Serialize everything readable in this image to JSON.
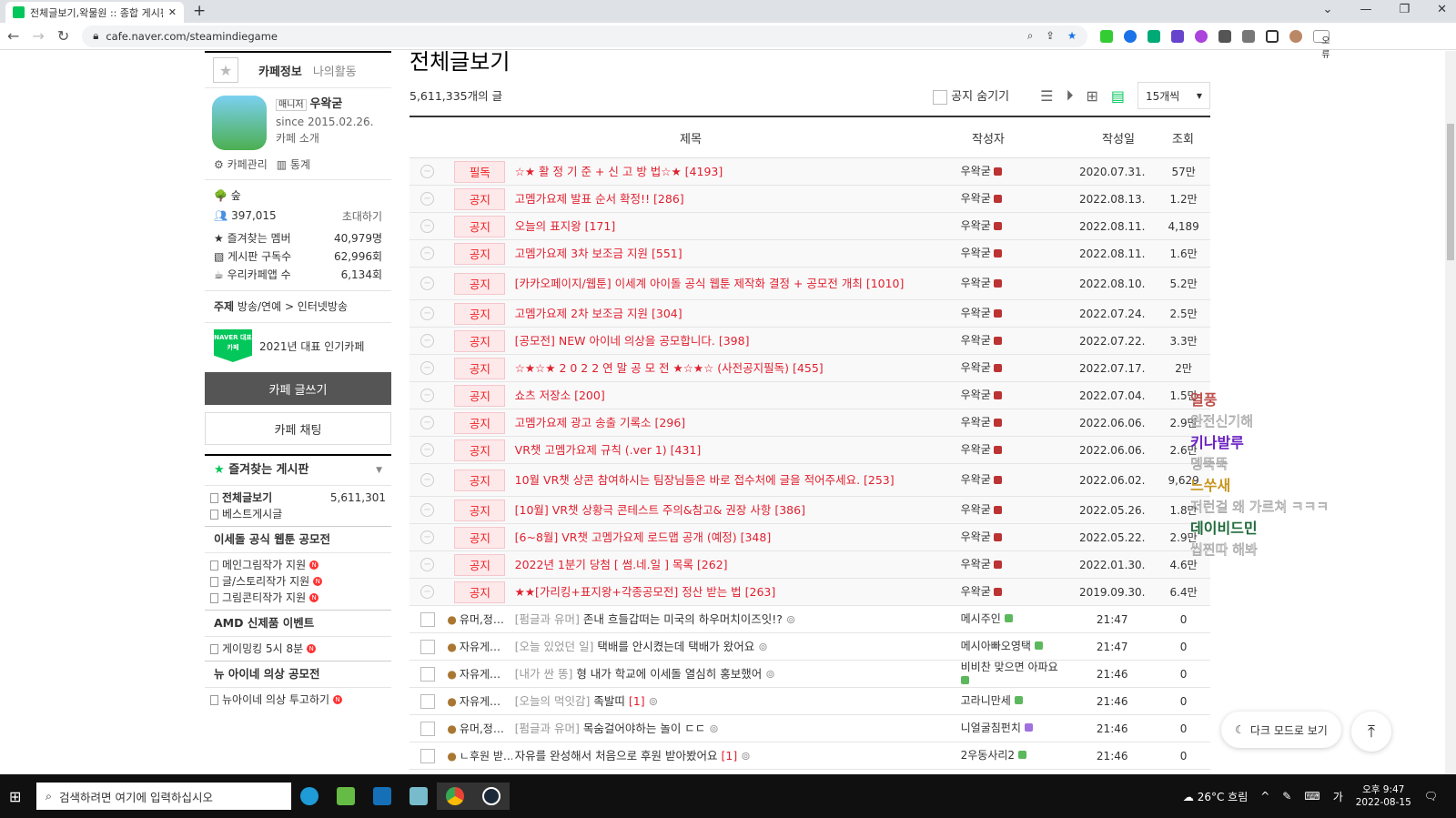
{
  "browser": {
    "tab_title": "전체글보기,왁물원 :: 종합 게시판",
    "url": "cafe.naver.com/steamindiegame",
    "profile": "오류"
  },
  "side": {
    "tabs": [
      "카페정보",
      "나의활동"
    ],
    "manager_label": "매니저",
    "manager": "우왁굳",
    "since": "since 2015.02.26.",
    "intro": "카페 소개",
    "admin": "카페관리",
    "stats": "통계",
    "level": "숲",
    "members": "397,015",
    "invite": "초대하기",
    "stats_rows": [
      {
        "label": "즐겨찾는 멤버",
        "value": "40,979명"
      },
      {
        "label": "게시판 구독수",
        "value": "62,996회"
      },
      {
        "label": "우리카페앱 수",
        "value": "6,134회"
      }
    ],
    "topic_label": "주제",
    "topic": "방송/연예 > 인터넷방송",
    "naver_badge": "NAVER 대표카페",
    "award": "2021년 대표 인기카페",
    "write": "카페 글쓰기",
    "chat": "카페 채팅",
    "fav_boards": "즐겨찾는 게시판",
    "all_posts": "전체글보기",
    "all_count": "5,611,301",
    "best": "베스트게시글",
    "sections": [
      {
        "title": "이세돌 공식 웹툰 공모전",
        "items": [
          "메인그림작가 지원",
          "글/스토리작가 지원",
          "그림콘티작가 지원"
        ]
      },
      {
        "title": "AMD 신제품 이벤트",
        "items": [
          "게이밍킹 5시 8분"
        ]
      },
      {
        "title": "뉴 아이네 의상 공모전",
        "items": [
          "뉴아이네 의상 투고하기"
        ]
      }
    ]
  },
  "main": {
    "title": "전체글보기",
    "count": "5,611,335개의 글",
    "hide_notice": "공지 숨기기",
    "per_page": "15개씩",
    "headers": [
      "제목",
      "작성자",
      "작성일",
      "조회"
    ],
    "notices": [
      {
        "badge": "필독",
        "title": "☆★ 활 정 기 준 + 신 고 방 법☆★ [4193]",
        "author": "우왁굳",
        "date": "2020.07.31.",
        "views": "57만"
      },
      {
        "badge": "공지",
        "title": "고멤가요제 발표 순서 확정!! [286]",
        "author": "우왁굳",
        "date": "2022.08.13.",
        "views": "1.2만"
      },
      {
        "badge": "공지",
        "title": "오늘의 표지왕 [171]",
        "author": "우왁굳",
        "date": "2022.08.11.",
        "views": "4,189"
      },
      {
        "badge": "공지",
        "title": "고멤가요제 3차 보조금 지원 [551]",
        "author": "우왁굳",
        "date": "2022.08.11.",
        "views": "1.6만"
      },
      {
        "badge": "공지",
        "title": "[카카오페이지/웹툰] 이세계 아이돌 공식 웹툰 제작화 결정 + 공모전 개최 [1010]",
        "author": "우왁굳",
        "date": "2022.08.10.",
        "views": "5.2만",
        "tall": true
      },
      {
        "badge": "공지",
        "title": "고멤가요제 2차 보조금 지원 [304]",
        "author": "우왁굳",
        "date": "2022.07.24.",
        "views": "2.5만"
      },
      {
        "badge": "공지",
        "title": "[공모전] NEW 아이네 의상을 공모합니다. [398]",
        "author": "우왁굳",
        "date": "2022.07.22.",
        "views": "3.3만"
      },
      {
        "badge": "공지",
        "title": "☆★☆★ 2 0 2 2 연 말 공 모 전 ★☆★☆ (사전공지필독) [455]",
        "author": "우왁굳",
        "date": "2022.07.17.",
        "views": "2만"
      },
      {
        "badge": "공지",
        "title": "쇼츠 저장소 [200]",
        "author": "우왁굳",
        "date": "2022.07.04.",
        "views": "1.5만"
      },
      {
        "badge": "공지",
        "title": "고멤가요제 광고 송출 기록소 [296]",
        "author": "우왁굳",
        "date": "2022.06.06.",
        "views": "2.9만"
      },
      {
        "badge": "공지",
        "title": "VR챗 고멤가요제 규칙 (.ver 1) [431]",
        "author": "우왁굳",
        "date": "2022.06.06.",
        "views": "2.6만"
      },
      {
        "badge": "공지",
        "title": "10월 VR챗 상콘 참여하시는 팀장님들은 바로 접수처에 글을 적어주세요. [253]",
        "author": "우왁굳",
        "date": "2022.06.02.",
        "views": "9,629",
        "tall": true
      },
      {
        "badge": "공지",
        "title": "[10월] VR챗 상황극 콘테스트 주의&참고& 권장 사항 [386]",
        "author": "우왁굳",
        "date": "2022.05.26.",
        "views": "1.8만"
      },
      {
        "badge": "공지",
        "title": "[6~8월] VR챗 고멤가요제 로드맵 공개 (예정) [348]",
        "author": "우왁굳",
        "date": "2022.05.22.",
        "views": "2.9만"
      },
      {
        "badge": "공지",
        "title": "2022년 1분기 당첨 [ 썸.네.일 ] 목록 [262]",
        "author": "우왁굳",
        "date": "2022.01.30.",
        "views": "4.6만"
      },
      {
        "badge": "공지",
        "title": "★★[가리킹+표지왕+각종공모전] 정산 받는 법 [263]",
        "author": "우왁굳",
        "date": "2019.09.30.",
        "views": "6.4만"
      }
    ],
    "posts": [
      {
        "board": "유머,정…",
        "prefix": "[펌글과 유머]",
        "title": "존내 흐들갑떠는 미국의 하우머치이즈잇!?",
        "cmt": "",
        "author": "메시주인",
        "date": "21:47",
        "views": "0",
        "lv": "#5cb85c"
      },
      {
        "board": "자유게…",
        "prefix": "[오늘 있었던 일]",
        "title": "택배를 안시켰는데 택배가 왔어요",
        "cmt": "",
        "author": "메시아빠오영택",
        "date": "21:47",
        "views": "0",
        "lv": "#5cb85c"
      },
      {
        "board": "자유게…",
        "prefix": "[내가 싼 똥]",
        "title": "형 내가 학교에 이세돌 열심히 홍보했어",
        "cmt": "",
        "author": "비비찬 맞으면 아파요",
        "date": "21:46",
        "views": "0",
        "lv": "#5cb85c"
      },
      {
        "board": "자유게…",
        "prefix": "[오늘의 먹잇감]",
        "title": "족발띠",
        "cmt": "[1]",
        "author": "고라니만세",
        "date": "21:46",
        "views": "0",
        "lv": "#5cb85c"
      },
      {
        "board": "유머,정…",
        "prefix": "[펌글과 유머]",
        "title": "목숨걸어야하는 놀이 ㄷㄷ",
        "cmt": "",
        "author": "니얼굴침펀치",
        "date": "21:46",
        "views": "0",
        "lv": "#a070e0"
      },
      {
        "board": "ㄴ후원 받…",
        "prefix": "",
        "title": "자유를 완성해서 처음으로 후원 받아봤어요",
        "cmt": "[1]",
        "author": "2우동사리2",
        "date": "21:46",
        "views": "0",
        "lv": "#5cb85c"
      }
    ]
  },
  "overlay": [
    {
      "name": "열풍",
      "msg": "완전신기해",
      "color": "#c0504d"
    },
    {
      "name": "키나발루",
      "msg": "뎅뚝뚝",
      "color": "#6a1fc0"
    },
    {
      "name": "느쑤새",
      "msg": "저런걸 왜 가르쳐 ㅋㅋㅋ",
      "color": "#c8961e"
    },
    {
      "name": "데이비드민",
      "msg": "씹찐따 해봐",
      "color": "#1e6a3a"
    }
  ],
  "dark_mode": "다크 모드로 보기",
  "taskbar": {
    "search": "검색하려면 여기에 입력하십시오",
    "weather": "26°C 흐림",
    "time": "오후 9:47",
    "date": "2022-08-15"
  }
}
